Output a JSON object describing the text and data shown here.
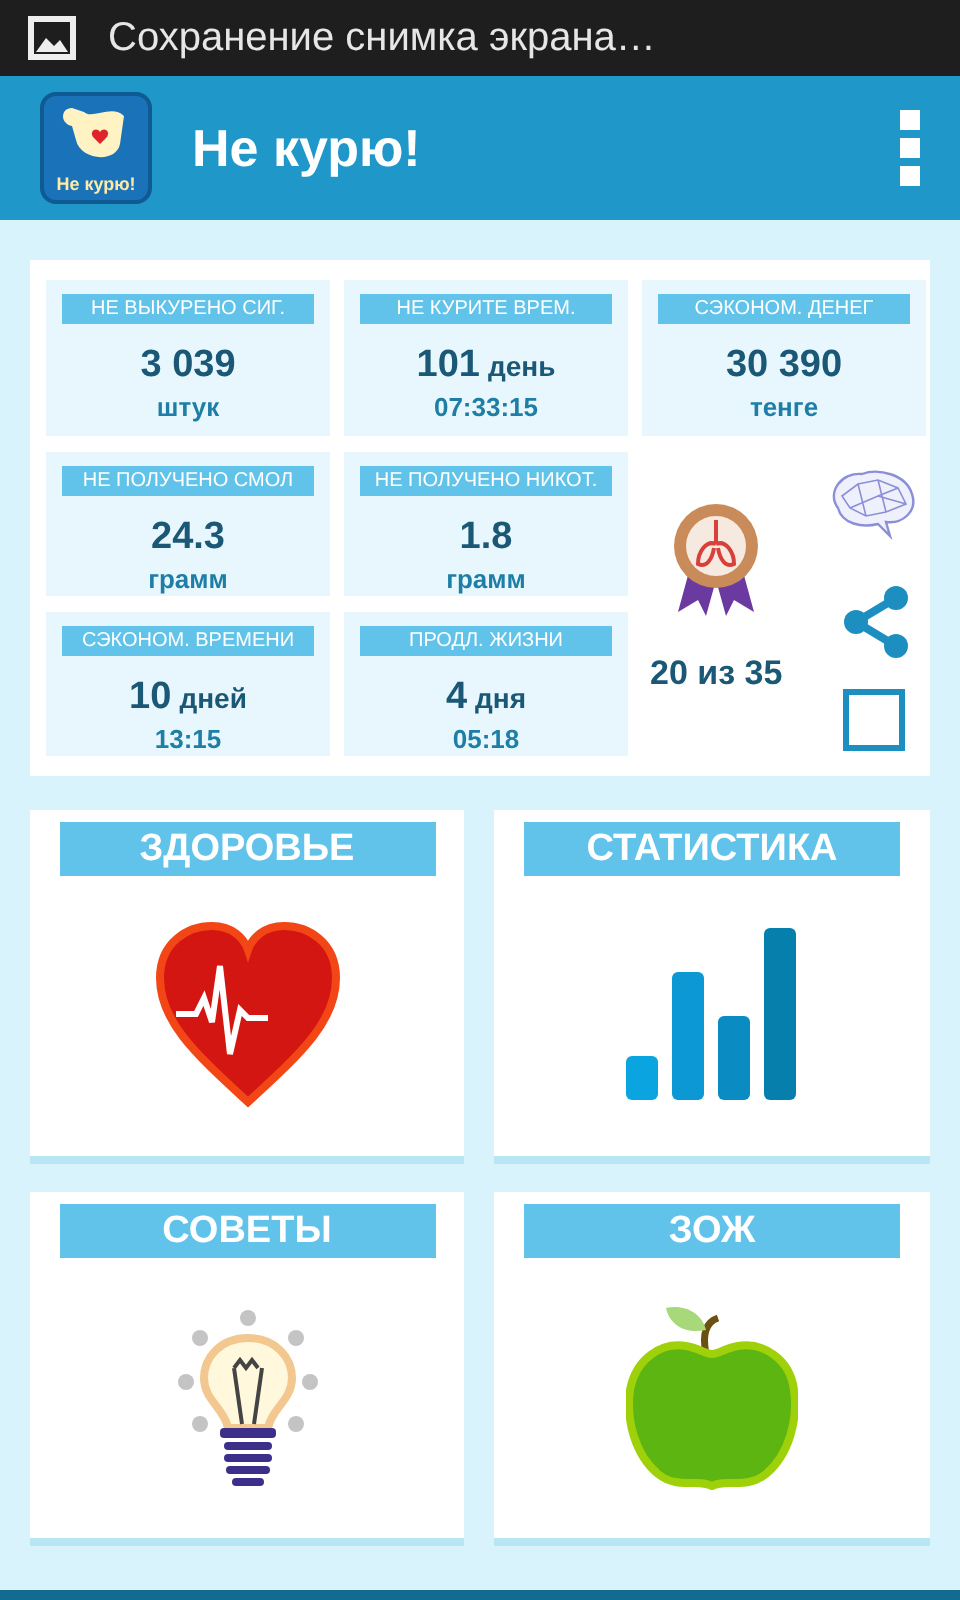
{
  "status_bar": {
    "notification": "Сохранение снимка экрана…"
  },
  "app_bar": {
    "logo_text": "Не курю!",
    "title": "Не курю!"
  },
  "stats": [
    {
      "kind": "count",
      "label": "НЕ ВЫКУРЕНО СИГ.",
      "value": "3 039",
      "unit": "штук"
    },
    {
      "kind": "duration",
      "label": "НЕ КУРИТЕ ВРЕМ.",
      "value": "101",
      "unit": "день",
      "time": "07:33:15"
    },
    {
      "kind": "count",
      "label": "СЭКОНОМ. ДЕНЕГ",
      "value": "30 390",
      "unit": "тенге"
    },
    {
      "kind": "count",
      "label": "НЕ ПОЛУЧЕНО СМОЛ",
      "value": "24.3",
      "unit": "грамм"
    },
    {
      "kind": "count",
      "label": "НЕ ПОЛУЧЕНО НИКОТ.",
      "value": "1.8",
      "unit": "грамм"
    },
    {
      "kind": "duration",
      "label": "СЭКОНОМ. ВРЕМЕНИ",
      "value": "10",
      "unit": "дней",
      "time": "13:15"
    },
    {
      "kind": "duration",
      "label": "ПРОДЛ. ЖИЗНИ",
      "value": "4",
      "unit": "дня",
      "time": "05:18"
    }
  ],
  "achievements": {
    "progress": "20 из 35",
    "checked": false
  },
  "sections": [
    {
      "kind": "heart",
      "title": "ЗДОРОВЬЕ"
    },
    {
      "kind": "bars",
      "title": "СТАТИСТИКА"
    },
    {
      "kind": "bulb",
      "title": "СОВЕТЫ"
    },
    {
      "kind": "apple",
      "title": "ЗОЖ"
    }
  ]
}
